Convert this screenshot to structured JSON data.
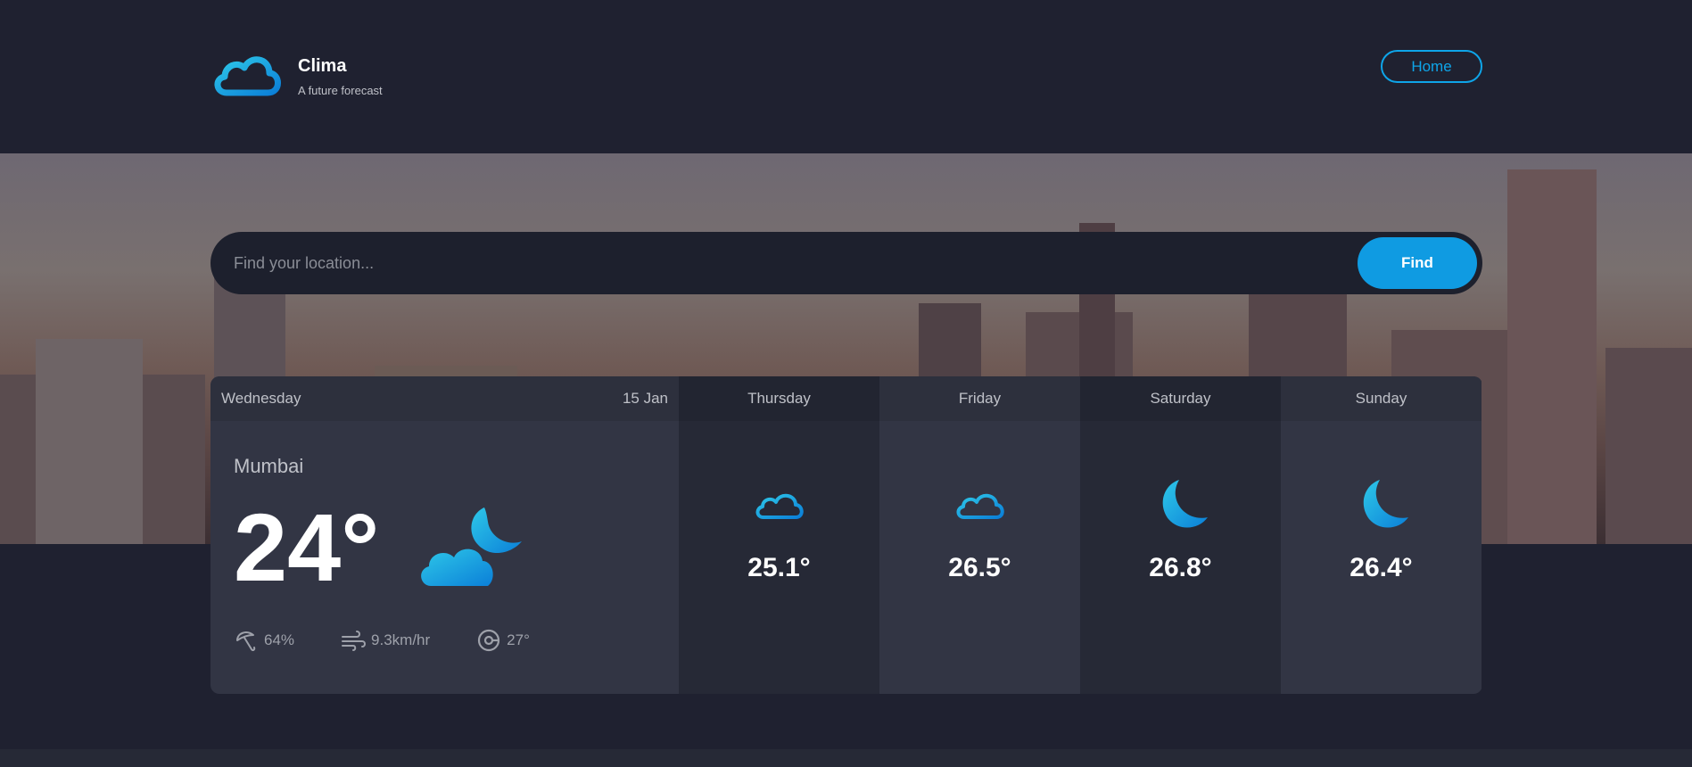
{
  "app": {
    "name": "Clima",
    "tagline": "A future forecast",
    "logo_icon": "cloud-logo-icon"
  },
  "nav": {
    "home_label": "Home"
  },
  "search": {
    "placeholder": "Find your location...",
    "value": "",
    "button_label": "Find"
  },
  "colors": {
    "accent": "#0ea5e9",
    "background": "#1f2130",
    "card": "#323544",
    "card_dark": "#262936"
  },
  "today": {
    "day": "Wednesday",
    "date": "15 Jan",
    "city": "Mumbai",
    "temperature": "24°",
    "icon": "cloud-moon-icon",
    "humidity": "64%",
    "wind": "9.3km/hr",
    "direction": "27°"
  },
  "forecast": [
    {
      "day": "Thursday",
      "temperature": "25.1°",
      "icon": "cloud-icon"
    },
    {
      "day": "Friday",
      "temperature": "26.5°",
      "icon": "cloud-icon"
    },
    {
      "day": "Saturday",
      "temperature": "26.8°",
      "icon": "moon-icon"
    },
    {
      "day": "Sunday",
      "temperature": "26.4°",
      "icon": "moon-icon"
    }
  ]
}
